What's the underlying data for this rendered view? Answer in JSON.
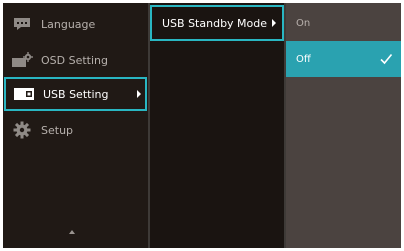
{
  "main_menu": {
    "items": [
      {
        "label": "Language",
        "icon": "language-icon"
      },
      {
        "label": "OSD Setting",
        "icon": "osd-setting-icon"
      },
      {
        "label": "USB Setting",
        "icon": "usb-setting-icon",
        "selected": true
      },
      {
        "label": "Setup",
        "icon": "gear-icon"
      }
    ]
  },
  "submenu": {
    "items": [
      {
        "label": "USB Standby Mode",
        "selected": true
      }
    ]
  },
  "options": {
    "items": [
      {
        "label": "On",
        "selected": false
      },
      {
        "label": "Off",
        "selected": true
      }
    ]
  },
  "colors": {
    "accent": "#29b6c2",
    "selected_option_bg": "#2aa2b0",
    "main_bg": "#1a1411",
    "options_bg": "#4b4340"
  }
}
